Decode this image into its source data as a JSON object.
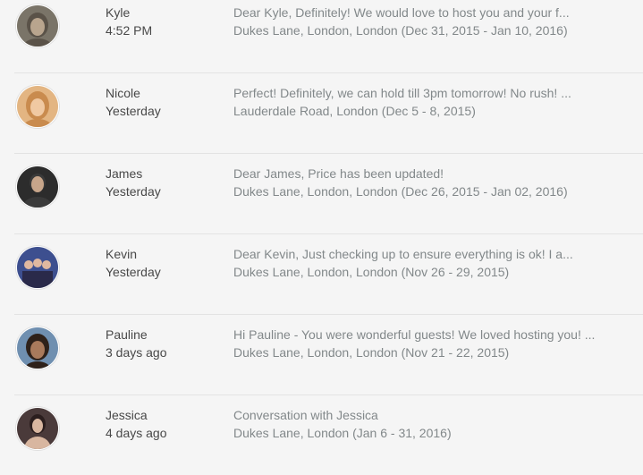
{
  "threads": [
    {
      "name": "Kyle",
      "time": "4:52 PM",
      "preview": "Dear Kyle, Definitely! We would love to host you and your f...",
      "listing": "Dukes Lane, London, London (Dec 31, 2015 - Jan 10, 2016)",
      "avatar": {
        "bg": "#7a7468",
        "face": "#b9a58e",
        "hair": "#5a5248"
      }
    },
    {
      "name": "Nicole",
      "time": "Yesterday",
      "preview": "Perfect! Definitely, we can hold till 3pm tomorrow! No rush! ...",
      "listing": "Lauderdale Road, London (Dec 5 - 8, 2015)",
      "avatar": {
        "bg": "#e3b582",
        "face": "#f0c9a2",
        "hair": "#c98b4e"
      }
    },
    {
      "name": "James",
      "time": "Yesterday",
      "preview": "Dear James, Price has been updated!",
      "listing": "Dukes Lane, London, London (Dec 26, 2015 - Jan 02, 2016)",
      "avatar": {
        "bg": "#2c2c2c",
        "face": "#c7a58a",
        "hair": "#3a3a3a"
      }
    },
    {
      "name": "Kevin",
      "time": "Yesterday",
      "preview": "Dear Kevin, Just checking up to ensure everything is ok! I a...",
      "listing": "Dukes Lane, London, London (Nov 26 - 29, 2015)",
      "avatar": {
        "bg": "#3d4f8f",
        "face": "#e0b8a0",
        "hair": "#2a2a4a"
      }
    },
    {
      "name": "Pauline",
      "time": "3 days ago",
      "preview": "Hi Pauline - You were wonderful guests! We loved hosting you! ...",
      "listing": "Dukes Lane, London, London (Nov 21 - 22, 2015)",
      "avatar": {
        "bg": "#6f8fb0",
        "face": "#a97a5c",
        "hair": "#2e211a"
      }
    },
    {
      "name": "Jessica",
      "time": "4 days ago",
      "preview": "Conversation with Jessica",
      "listing": "Dukes Lane, London (Jan 6 - 31, 2016)",
      "avatar": {
        "bg": "#4a3a3a",
        "face": "#d8b6a0",
        "hair": "#2b1e1e"
      }
    }
  ]
}
